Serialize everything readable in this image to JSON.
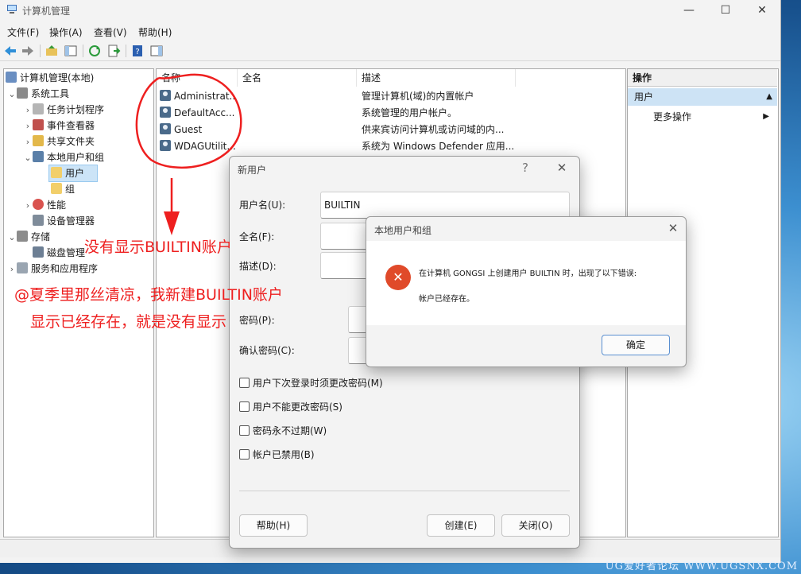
{
  "window": {
    "title": "计算机管理",
    "controls": {
      "minimize": "—",
      "maximize": "☐",
      "close": "✕"
    }
  },
  "menu": [
    "文件(F)",
    "操作(A)",
    "查看(V)",
    "帮助(H)"
  ],
  "tree": {
    "root": "计算机管理(本地)",
    "system_tools": "系统工具",
    "task_scheduler": "任务计划程序",
    "event_viewer": "事件查看器",
    "shared_folders": "共享文件夹",
    "local_users_groups": "本地用户和组",
    "users": "用户",
    "groups": "组",
    "performance": "性能",
    "device_manager": "设备管理器",
    "storage": "存储",
    "disk_management": "磁盘管理",
    "services_apps": "服务和应用程序"
  },
  "list": {
    "columns": [
      "名称",
      "全名",
      "描述"
    ],
    "rows": [
      {
        "name": "Administrat...",
        "full": "",
        "desc": "管理计算机(域)的内置帐户"
      },
      {
        "name": "DefaultAcc...",
        "full": "",
        "desc": "系统管理的用户帐户。"
      },
      {
        "name": "Guest",
        "full": "",
        "desc": "供来宾访问计算机或访问域的内..."
      },
      {
        "name": "WDAGUtilit...",
        "full": "",
        "desc": "系统为 Windows Defender 应用..."
      }
    ]
  },
  "actions": {
    "header": "操作",
    "section": "用户",
    "more": "更多操作"
  },
  "new_user_dialog": {
    "title": "新用户",
    "help_glyph": "?",
    "close_glyph": "✕",
    "username_label": "用户名(U):",
    "username_value": "BUILTIN",
    "fullname_label": "全名(F):",
    "desc_label": "描述(D):",
    "password_label": "密码(P):",
    "confirm_label": "确认密码(C):",
    "checks": [
      "用户下次登录时须更改密码(M)",
      "用户不能更改密码(S)",
      "密码永不过期(W)",
      "帐户已禁用(B)"
    ],
    "help_btn": "帮助(H)",
    "create_btn": "创建(E)",
    "close_btn": "关闭(O)"
  },
  "error_dialog": {
    "title": "本地用户和组",
    "close_glyph": "✕",
    "icon_glyph": "✕",
    "message": "在计算机 GONGSI 上创建用户 BUILTIN 时，出现了以下错误:",
    "detail": "帐户已经存在。",
    "ok_btn": "确定"
  },
  "annotations": {
    "line1": "没有显示BUILTIN账户",
    "line2": "@夏季里那丝清凉，我新建BUILTIN账户",
    "line3": "显示已经存在，就是没有显示"
  },
  "watermark": "UG爱好者论坛 WWW.UGSNX.COM",
  "colors": {
    "annotation": "#ee1f1f",
    "selection": "#cce4f7",
    "error_icon": "#e04a2a"
  }
}
